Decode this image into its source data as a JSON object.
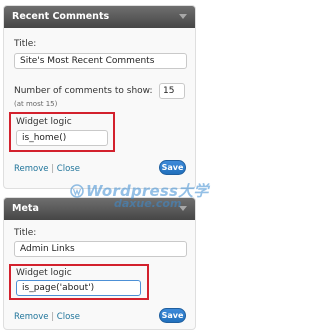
{
  "widgets": [
    {
      "title": "Recent Comments",
      "title_label": "Title:",
      "title_value": "Site's Most Recent Comments",
      "number_label": "Number of comments to show:",
      "number_value": "15",
      "number_hint": "(at most 15)",
      "logic_label": "Widget logic",
      "logic_value": "is_home()",
      "remove_label": "Remove",
      "separator": "|",
      "close_label": "Close",
      "save_label": "Save"
    },
    {
      "title": "Meta",
      "title_label": "Title:",
      "title_value": "Admin Links",
      "logic_label": "Widget logic",
      "logic_value": "is_page('about')",
      "remove_label": "Remove",
      "separator": "|",
      "close_label": "Close",
      "save_label": "Save"
    }
  ],
  "watermark": {
    "line1": "Wordpress大学",
    "line2": "daxue.com"
  },
  "colors": {
    "titlebar": "#5a5a5a",
    "highlight_box": "#d3212d",
    "link": "#21759b",
    "save_button": "#2b7bcb"
  }
}
